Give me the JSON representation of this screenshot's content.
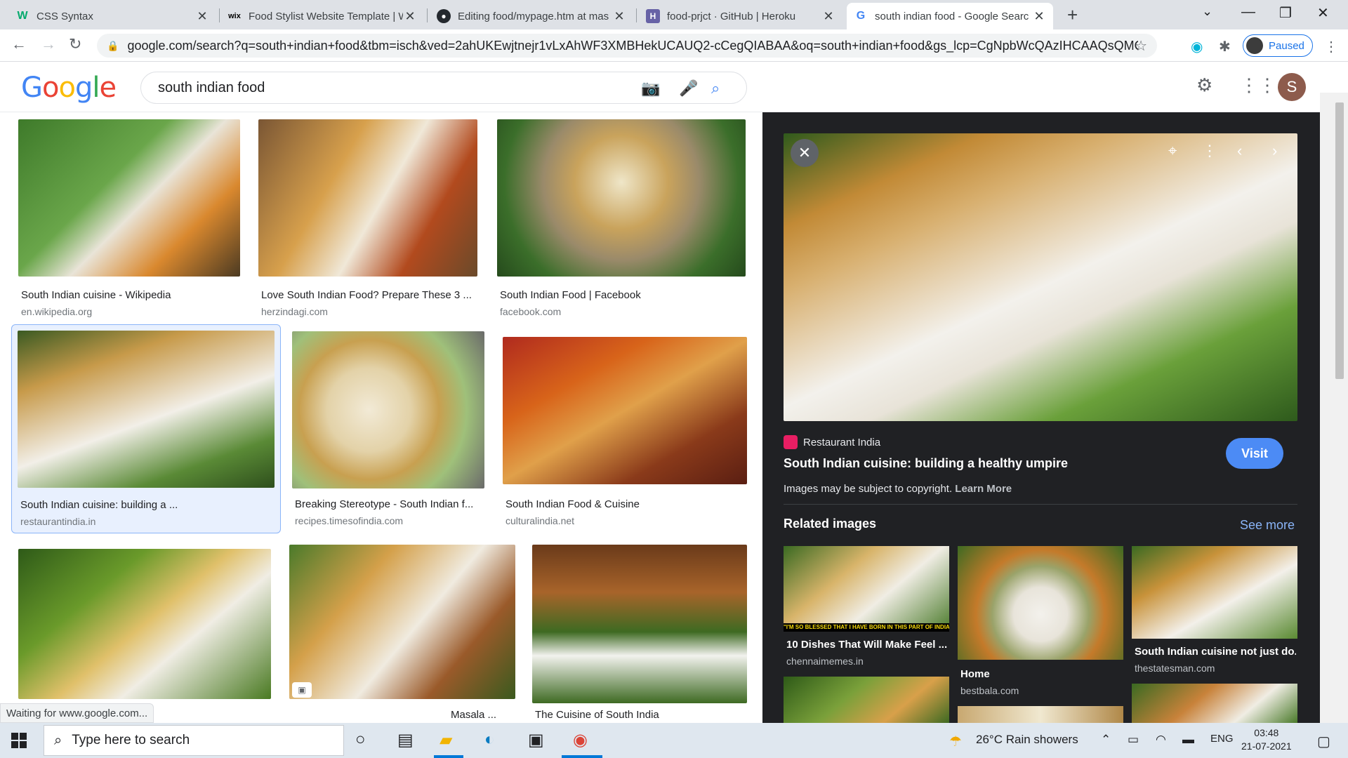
{
  "browser": {
    "tabs": [
      {
        "title": "CSS Syntax",
        "favicon": "W"
      },
      {
        "title": "Food Stylist Website Template | W",
        "favicon": "wix"
      },
      {
        "title": "Editing food/mypage.htm at mas",
        "favicon": "github"
      },
      {
        "title": "food-prjct · GitHub | Heroku",
        "favicon": "H"
      },
      {
        "title": "south indian food - Google Searc",
        "favicon": "G"
      }
    ],
    "url": "google.com/search?q=south+indian+food&tbm=isch&ved=2ahUKEwjtnejr1vLxAhWF3XMBHekUCAUQ2-cCegQIABAA&oq=south+indian+food&gs_lcp=CgNpbWcQAzIHCAAQsQMQQzI...",
    "profile_status": "Paused"
  },
  "google": {
    "logo_letters": [
      {
        "ch": "G",
        "color": "#4285f4"
      },
      {
        "ch": "o",
        "color": "#ea4335"
      },
      {
        "ch": "o",
        "color": "#fbbc05"
      },
      {
        "ch": "g",
        "color": "#4285f4"
      },
      {
        "ch": "l",
        "color": "#34a853"
      },
      {
        "ch": "e",
        "color": "#ea4335"
      }
    ],
    "query": "south indian food",
    "avatar_letter": "S"
  },
  "results": [
    {
      "title": "South Indian cuisine - Wikipedia",
      "source": "en.wikipedia.org"
    },
    {
      "title": "Love South Indian Food? Prepare These 3 ...",
      "source": "herzindagi.com"
    },
    {
      "title": "South Indian Food | Facebook",
      "source": "facebook.com"
    },
    {
      "title": "South Indian cuisine: building a ...",
      "source": "restaurantindia.in"
    },
    {
      "title": "Breaking Stereotype - South Indian f...",
      "source": "recipes.timesofindia.com"
    },
    {
      "title": "South Indian Food & Cuisine",
      "source": "culturalindia.net"
    },
    {
      "title": "",
      "source": ""
    },
    {
      "title": "Masala ...",
      "source": ""
    },
    {
      "title": "The Cuisine of South India",
      "source": ""
    }
  ],
  "panel": {
    "source": "Restaurant India",
    "title": "South Indian cuisine: building a healthy umpire",
    "visit_label": "Visit",
    "copyright": "Images may be subject to copyright.",
    "learn_more": "Learn More",
    "related_heading": "Related images",
    "see_more": "See more",
    "related": [
      {
        "title": "10 Dishes That Will Make Feel ...",
        "source": "chennaimemes.in",
        "caption": "\"I'M SO BLESSED THAT I HAVE BORN IN THIS PART OF INDIA\""
      },
      {
        "title": "Home",
        "source": "bestbala.com"
      },
      {
        "title": "South Indian cuisine not just do...",
        "source": "thestatesman.com"
      }
    ]
  },
  "status_text": "Waiting for www.google.com...",
  "taskbar": {
    "search_placeholder": "Type here to search",
    "weather": "26°C  Rain showers",
    "language": "ENG",
    "time": "03:48",
    "date": "21-07-2021"
  }
}
